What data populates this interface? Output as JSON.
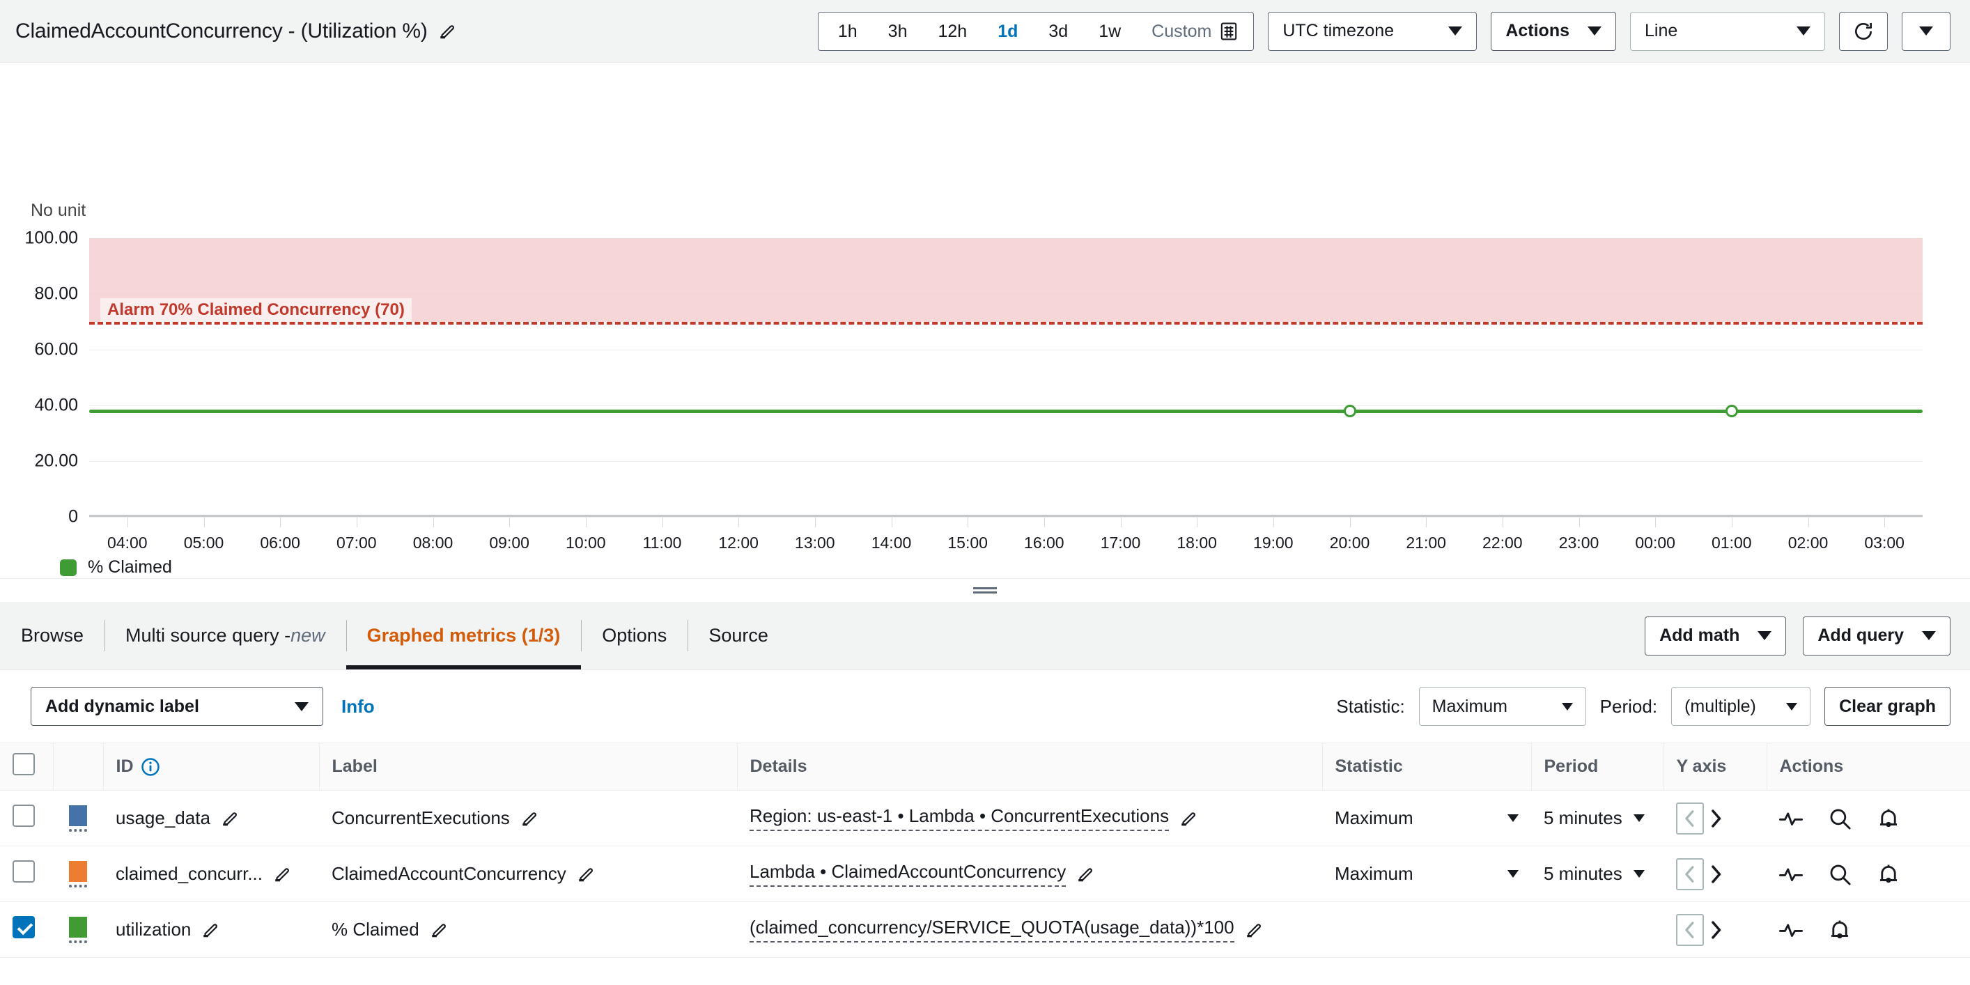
{
  "header": {
    "title": "ClaimedAccountConcurrency - (Utilization %)",
    "edit_icon": "pencil-icon",
    "time_ranges": [
      "1h",
      "3h",
      "12h",
      "1d",
      "3d",
      "1w"
    ],
    "active_range": "1d",
    "custom_label": "Custom",
    "timezone": "UTC timezone",
    "actions_label": "Actions",
    "chart_type": "Line",
    "refresh_icon": "refresh-icon"
  },
  "chart_data": {
    "type": "line",
    "title": "ClaimedAccountConcurrency - (Utilization %)",
    "unit_label": "No unit",
    "xlabel": "",
    "ylabel": "",
    "ylim": [
      0,
      100
    ],
    "yticks": [
      "0",
      "20.00",
      "40.00",
      "60.00",
      "80.00",
      "100.00"
    ],
    "ytick_values": [
      0,
      20,
      40,
      60,
      80,
      100
    ],
    "grid": true,
    "legend_position": "bottom-left",
    "x": [
      "04:00",
      "05:00",
      "06:00",
      "07:00",
      "08:00",
      "09:00",
      "10:00",
      "11:00",
      "12:00",
      "13:00",
      "14:00",
      "15:00",
      "16:00",
      "17:00",
      "18:00",
      "19:00",
      "20:00",
      "21:00",
      "22:00",
      "23:00",
      "00:00",
      "01:00",
      "02:00",
      "03:00"
    ],
    "series": [
      {
        "name": "% Claimed",
        "color": "#3f9c35",
        "values": [
          38,
          38,
          38,
          38,
          38,
          38,
          38,
          38,
          38,
          38,
          38,
          38,
          38,
          38,
          38,
          38,
          38,
          38,
          38,
          38,
          38,
          38,
          38,
          38
        ]
      }
    ],
    "annotations": [
      {
        "label": "Alarm 70% Claimed Concurrency (70)",
        "value": 70,
        "color": "#c0392b",
        "fill_color": "#f4cfcf",
        "fill_to": 100,
        "style": "dashed"
      }
    ],
    "markers": [
      {
        "x": "20:00",
        "y": 38
      },
      {
        "x": "01:00",
        "y": 38
      }
    ]
  },
  "tabs": {
    "items": [
      {
        "label": "Browse",
        "active": false
      },
      {
        "label": "Multi source query - ",
        "suffix": "new",
        "active": false
      },
      {
        "label": "Graphed metrics (1/3)",
        "active": true
      },
      {
        "label": "Options",
        "active": false
      },
      {
        "label": "Source",
        "active": false
      }
    ],
    "add_math": "Add math",
    "add_query": "Add query"
  },
  "controls": {
    "add_dynamic_label": "Add dynamic label",
    "info": "Info",
    "statistic_label": "Statistic:",
    "statistic_value": "Maximum",
    "period_label": "Period:",
    "period_value": "(multiple)",
    "clear_graph": "Clear graph"
  },
  "table": {
    "columns": [
      "",
      "",
      "ID",
      "Label",
      "Details",
      "Statistic",
      "Period",
      "Y axis",
      "Actions"
    ],
    "id_info_icon": "info-icon",
    "rows": [
      {
        "checked": false,
        "color": "#4572a7",
        "id": "usage_data",
        "label": "ConcurrentExecutions",
        "details": "Region: us-east-1 • Lambda • ConcurrentExecutions",
        "statistic": "Maximum",
        "period": "5 minutes",
        "has_search_action": true
      },
      {
        "checked": false,
        "color": "#ed7d31",
        "id": "claimed_concurr...",
        "label": "ClaimedAccountConcurrency",
        "details": "Lambda • ClaimedAccountConcurrency",
        "statistic": "Maximum",
        "period": "5 minutes",
        "has_search_action": true
      },
      {
        "checked": true,
        "color": "#3f9c35",
        "id": "utilization",
        "label": "% Claimed",
        "details": "(claimed_concurrency/SERVICE_QUOTA(usage_data))*100",
        "statistic": "",
        "period": "",
        "has_search_action": false
      }
    ]
  }
}
